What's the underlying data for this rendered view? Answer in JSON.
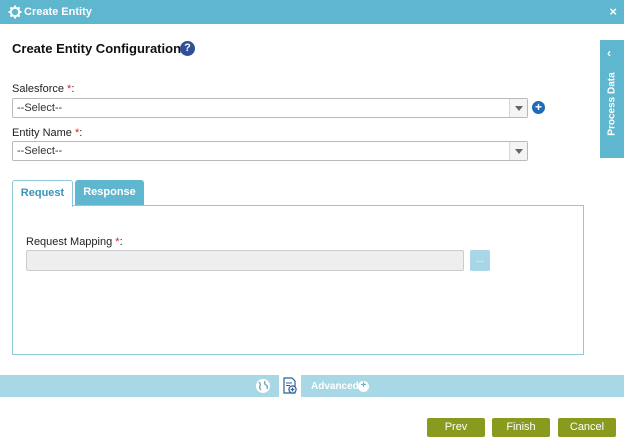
{
  "window": {
    "title": "Create Entity",
    "close": "×"
  },
  "config": {
    "title": "Create Entity Configuration",
    "help": "?"
  },
  "fields": {
    "salesforce": {
      "label": "Salesforce",
      "required_mark": "*",
      "colon": ":",
      "value": "--Select--"
    },
    "entity_name": {
      "label": "Entity Name",
      "required_mark": "*",
      "colon": ":",
      "value": "--Select--"
    }
  },
  "side_panel": {
    "chevron": "‹",
    "label": "Process Data"
  },
  "tabs": {
    "request": "Request",
    "response": "Response"
  },
  "request_panel": {
    "mapping_label": "Request Mapping",
    "required_mark": "*",
    "colon": ":",
    "mapping_value": "",
    "ellipsis": "..."
  },
  "bottom_bar": {
    "advanced_label": "Advanced",
    "plus": "+"
  },
  "buttons": {
    "prev": "Prev",
    "finish": "Finish",
    "cancel": "Cancel"
  },
  "colors": {
    "header": "#5fb6cf",
    "bottom_bar": "#a8d7e6",
    "action_button": "#8a9a1e",
    "required": "#d9262a",
    "help": "#2f4f9a"
  },
  "icons": [
    "gear-icon",
    "close-icon",
    "help-icon",
    "add-icon",
    "chevron-left-icon",
    "globe-icon",
    "document-add-icon",
    "plus-icon"
  ]
}
